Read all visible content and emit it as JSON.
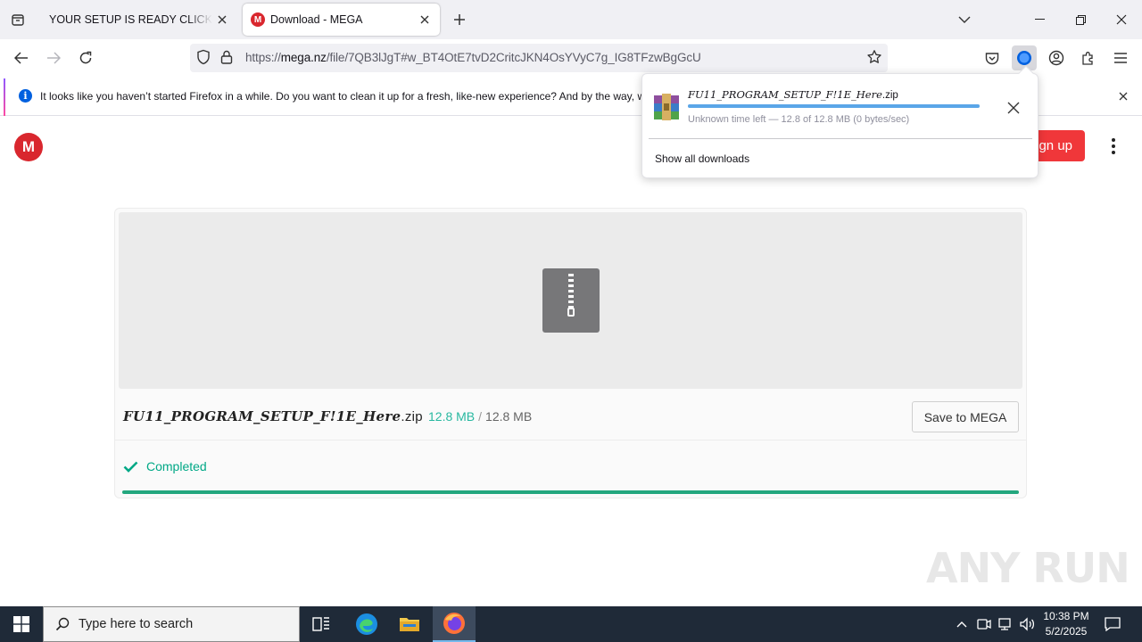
{
  "browser": {
    "tabs": [
      {
        "title": "YOUR SETUP IS READY CLICK BELOW",
        "active": false
      },
      {
        "title": "Download - MEGA",
        "active": true
      }
    ],
    "url": {
      "prefix": "https://",
      "host": "mega.nz",
      "path": "/file/7QB3lJgT#w_BT4OtE7tvD2CritcJKN4OsYVyC7g_IG8TFzwBgGcU"
    }
  },
  "notification": {
    "message": "It looks like you haven’t started Firefox in a while. Do you want to clean it up for a fresh, like-new experience? And by the way, w"
  },
  "downloads_panel": {
    "file_name_base": "FU11_PROGRAM_SETUP_F!1E_Here",
    "file_ext": ".zip",
    "status": "Unknown time left — 12.8 of 12.8 MB (0 bytes/sec)",
    "progress": 1.0,
    "show_all_label": "Show all downloads"
  },
  "page": {
    "signup_label": "Sign up",
    "file": {
      "name_base": "FU11_PROGRAM_SETUP_F!1E_Here",
      "ext": ".zip",
      "downloaded": "12.8 MB",
      "separator": "/",
      "total": "12.8 MB"
    },
    "save_label": "Save to MEGA",
    "status_label": "Completed",
    "progress": 1.0
  },
  "watermark": "ANY RUN",
  "taskbar": {
    "search_placeholder": "Type here to search",
    "time": "10:38 PM",
    "date": "5/2/2025"
  },
  "colors": {
    "mega_red": "#d9272e",
    "completed_green": "#00a886",
    "progress_green": "#23a77e",
    "download_blue": "#5aa6e8"
  }
}
